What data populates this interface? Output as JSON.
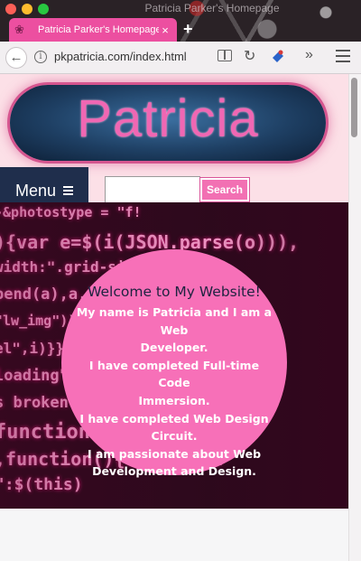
{
  "window": {
    "title": "Patricia Parker's Homepage"
  },
  "tab": {
    "title": "Patricia Parker's Homepage",
    "close_glyph": "×",
    "new_tab_glyph": "+"
  },
  "toolbar": {
    "back_glyph": "←",
    "info_glyph": "i",
    "url": "pkpatricia.com/index.html",
    "reload_glyph": "↻",
    "overflow_glyph": "»"
  },
  "header": {
    "logo_text": "Patricia"
  },
  "nav": {
    "menu_label": "Menu",
    "search_value": "",
    "search_button": "Search"
  },
  "hero": {
    "code_lines": [
      "-&photostype = \"f!",
      "){var e=$(i(JSON.parse(o))),",
      "width:\".grid-si",
      "pend(a),a.ima",
      "\"lw_img\")){",
      "el\",i)}}}",
      "loading\")}}",
      "s broken\"),$(",
      "function Init_sort_",
      ",function(){console.l",
      "\":$(this)"
    ],
    "welcome": {
      "title": "Welcome to My Website!",
      "lines": [
        "My name is Patricia and I am a Web",
        "Developer.",
        "I have completed Full-time Code",
        "Immersion.",
        "I have completed Web Design Circuit.",
        "I am passionate about Web",
        "Development and Design."
      ]
    }
  },
  "colors": {
    "page_bg": "#fce0e7",
    "accent_pink": "#f770b8",
    "menu_navy": "#1f2e4c",
    "tab_pink": "#ec4fa0"
  }
}
